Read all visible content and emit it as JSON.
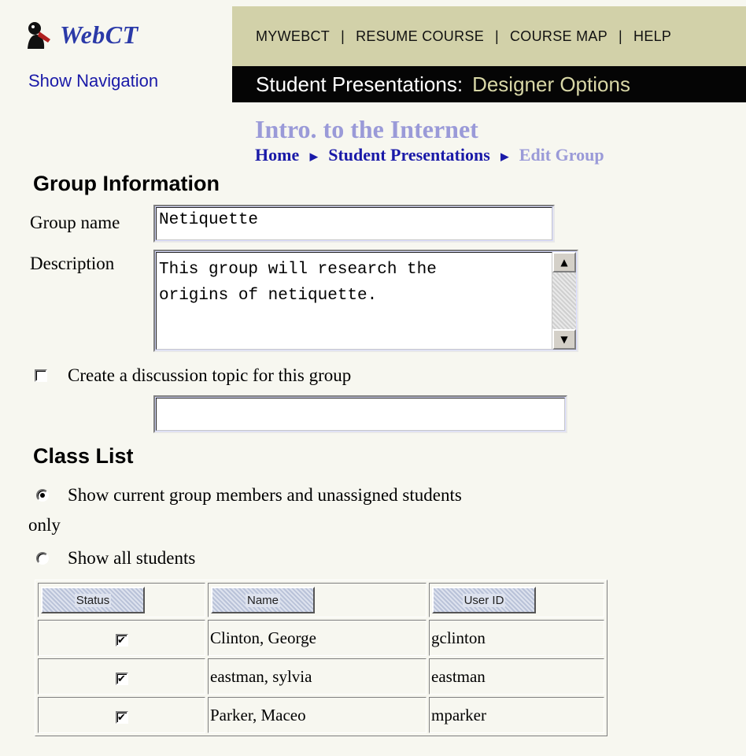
{
  "logo": {
    "text": "WebCT",
    "icon": "webct-logo-icon"
  },
  "show_navigation": "Show Navigation",
  "top_nav": {
    "items": [
      "MYWEBCT",
      "RESUME COURSE",
      "COURSE MAP",
      "HELP"
    ],
    "separator": "|"
  },
  "title_bar": {
    "tool": "Student Presentations:",
    "mode": "Designer Options"
  },
  "course_title": "Intro. to the Internet",
  "breadcrumb": {
    "items": [
      "Home",
      "Student Presentations"
    ],
    "current": "Edit Group"
  },
  "group_info": {
    "heading": "Group Information",
    "name_label": "Group name",
    "name_value": "Netiquette",
    "description_label": "Description",
    "description_value": "This group will research the\norigins of netiquette.",
    "discussion_checkbox_label": "Create a discussion topic for this group",
    "discussion_checked": false,
    "discussion_topic_value": ""
  },
  "class_list": {
    "heading": "Class List",
    "radio_current_line1": "Show current group members and unassigned students",
    "radio_current_line2": "only",
    "radio_all": "Show all students",
    "selected": "current",
    "columns": [
      "Status",
      "Name",
      "User ID"
    ],
    "rows": [
      {
        "checked": true,
        "name": "Clinton, George",
        "user_id": "gclinton"
      },
      {
        "checked": true,
        "name": "eastman, sylvia",
        "user_id": "eastman"
      },
      {
        "checked": true,
        "name": "Parker, Maceo",
        "user_id": "mparker"
      }
    ]
  },
  "colors": {
    "top_nav_bg": "#d2d1a9",
    "title_bar_bg": "#050505",
    "link_blue": "#1a1aa8",
    "muted_blue": "#9a9ad8",
    "page_bg": "#f7f7f0"
  }
}
